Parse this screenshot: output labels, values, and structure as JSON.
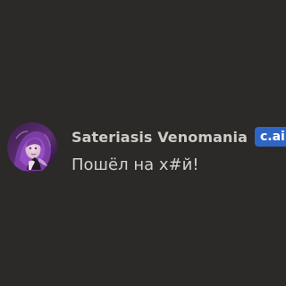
{
  "message": {
    "author": {
      "name": "Sateriasis Venomania",
      "badge": "c.ai",
      "avatar_icon": "character-avatar-icon"
    },
    "text": "Пошёл на х#й!"
  },
  "colors": {
    "background": "#2b2a29",
    "name": "#cfcac4",
    "text": "#d6d1cb",
    "badge_background": "#2f66c6",
    "badge_text": "#ffffff"
  }
}
